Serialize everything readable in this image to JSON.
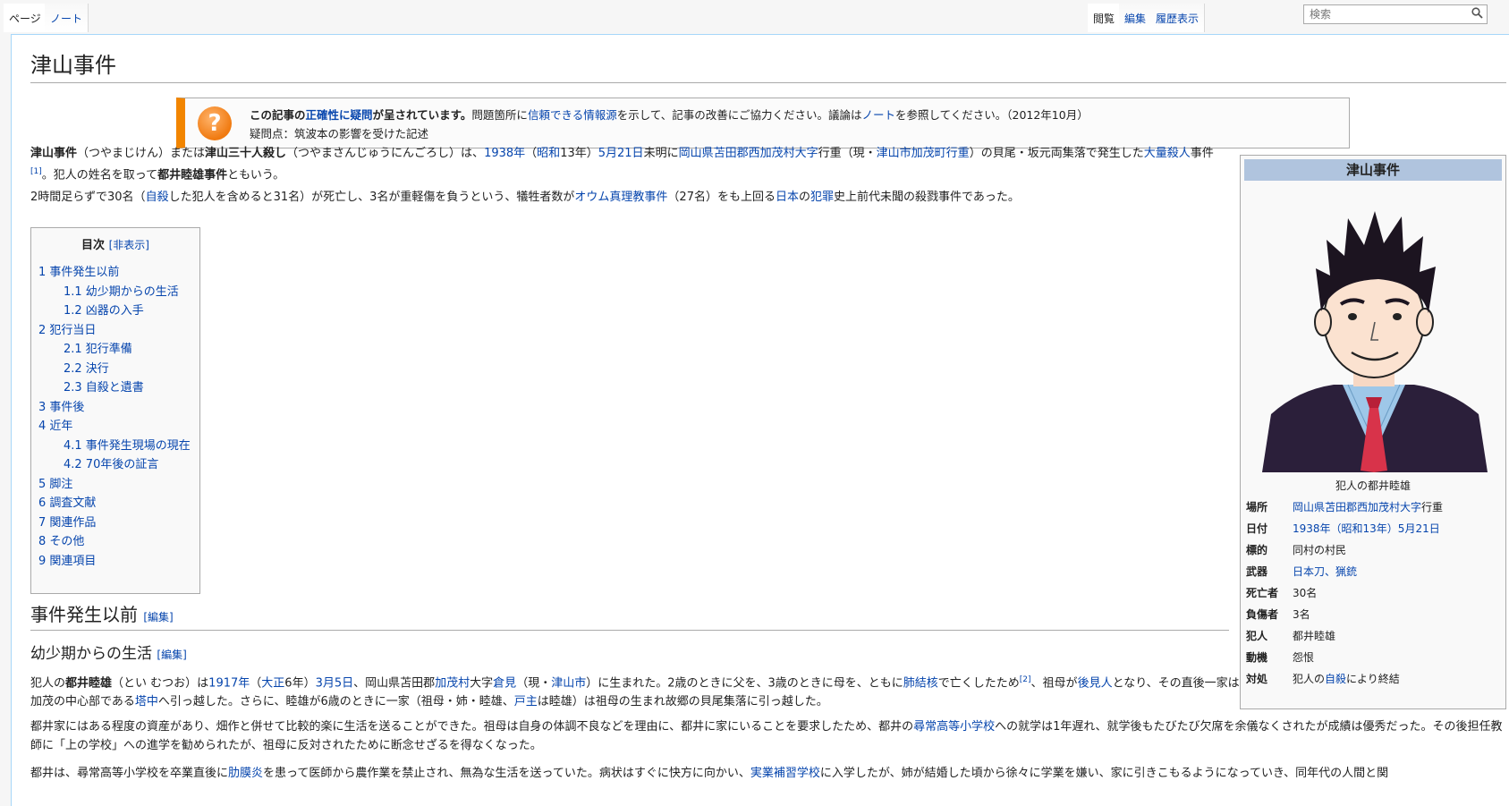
{
  "tabs": {
    "page": "ページ",
    "note": "ノート",
    "read": "閲覧",
    "edit": "編集",
    "history": "履歴表示"
  },
  "search": {
    "placeholder": "検索"
  },
  "article": {
    "title": "津山事件",
    "ambox": {
      "line1_prefix": "この記事の",
      "line1_link": "正確性に疑問",
      "line1_bold_suffix": "が呈されています。",
      "line1_text1": "問題箇所に",
      "line1_link2": "信頼できる情報源",
      "line1_text2": "を示して、記事の改善にご協力ください。議論は",
      "line1_link3": "ノート",
      "line1_text3": "を参照してください。（2012年10月）",
      "line2": "疑問点：筑波本の影響を受けた記述"
    },
    "intro": {
      "p1_a": "津山事件",
      "p1_b": "（つやまじけん）または",
      "p1_c": "津山三十人殺し",
      "p1_d": "（つやまさんじゅうにんごろし）は、",
      "p1_link1": "1938年",
      "p1_e": "（",
      "p1_link2": "昭和",
      "p1_f": "13年）",
      "p1_link3": "5月21日",
      "p1_g": "未明に",
      "p1_link4": "岡山県",
      "p1_link5": "苫田郡",
      "p1_link6": "西加茂村",
      "p1_link7": "大字",
      "p1_h": "行重（現・",
      "p1_link8": "津山市",
      "p1_link9": "加茂町行重",
      "p1_i": "）の貝尾・坂元両集落で発生した",
      "p1_link10": "大量殺人",
      "p1_j": "事件",
      "p1_ref": "[1]",
      "p1_k": "。犯人の姓名を取って",
      "p1_l": "都井睦雄事件",
      "p1_m": "ともいう。",
      "p2_a": "2時間足らずで30名（",
      "p2_link1": "自殺",
      "p2_b": "した犯人を含めると31名）が死亡し、3名が重軽傷を負うという、犠牲者数が",
      "p2_link2": "オウム真理教事件",
      "p2_c": "（27名）をも上回る",
      "p2_link3": "日本",
      "p2_d": "の",
      "p2_link4": "犯罪",
      "p2_e": "史上前代未聞の殺戮事件であった。"
    },
    "toc": {
      "title": "目次",
      "toggle": "[非表示]",
      "items": [
        {
          "text": "1 事件発生以前",
          "level": 1
        },
        {
          "text": "1.1 幼少期からの生活",
          "level": 2
        },
        {
          "text": "1.2 凶器の入手",
          "level": 2
        },
        {
          "text": "2 犯行当日",
          "level": 1
        },
        {
          "text": "2.1 犯行準備",
          "level": 2
        },
        {
          "text": "2.2 決行",
          "level": 2
        },
        {
          "text": "2.3 自殺と遺書",
          "level": 2
        },
        {
          "text": "3 事件後",
          "level": 1
        },
        {
          "text": "4 近年",
          "level": 1
        },
        {
          "text": "4.1 事件発生現場の現在",
          "level": 2
        },
        {
          "text": "4.2 70年後の証言",
          "level": 2
        },
        {
          "text": "5 脚注",
          "level": 1
        },
        {
          "text": "6 調査文献",
          "level": 1
        },
        {
          "text": "7 関連作品",
          "level": 1
        },
        {
          "text": "8 その他",
          "level": 1
        },
        {
          "text": "9 関連項目",
          "level": 1
        }
      ]
    },
    "section1": {
      "heading": "事件発生以前",
      "edit": "[編集]"
    },
    "section1_1": {
      "heading": "幼少期からの生活",
      "edit": "[編集]",
      "p1_a": "犯人の",
      "p1_b": "都井睦雄",
      "p1_c": "（とい むつお）は",
      "p1_link1": "1917年",
      "p1_d": "（",
      "p1_link2": "大正",
      "p1_e": "6年）",
      "p1_link3": "3月5日",
      "p1_f": "、岡山県苫田郡",
      "p1_link4": "加茂村",
      "p1_g": "大字",
      "p1_link5": "倉見",
      "p1_h": "（現・",
      "p1_link6": "津山市",
      "p1_i": "）に生まれた。2歳のときに父を、3歳のときに母を、ともに",
      "p1_link7": "肺結核",
      "p1_j": "で亡くしたため",
      "p1_ref": "[2]",
      "p1_k": "、祖母が",
      "p1_link8": "後見人",
      "p1_l": "となり、その直後一家は加茂の中心部である",
      "p1_link9": "塔中",
      "p1_m": "へ引っ越した。さらに、睦雄が6歳のときに一家（祖母・姉・睦雄、",
      "p1_link10": "戸主",
      "p1_n": "は睦雄）は祖母の生まれ故郷の貝尾集落に引っ越した。",
      "p2_a": "都井家にはある程度の資産があり、畑作と併せて比較的楽に生活を送ることができた。祖母は自身の体調不良などを理由に、都井に家にいることを要求したため、都井の",
      "p2_link1": "尋常高等小学校",
      "p2_b": "への就学は1年遅れ、就学後もたびたび欠席を余儀なくされたが成績は優秀だった。その後担任教師に「上の学校」への進学を勧められたが、祖母に反対されたために断念せざるを得なくなった。",
      "p3_a": "都井は、尋常高等小学校を卒業直後に",
      "p3_link1": "肋膜炎",
      "p3_b": "を患って医師から農作業を禁止され、無為な生活を送っていた。病状はすぐに快方に向かい、",
      "p3_link2": "実業補習学校",
      "p3_c": "に入学したが、姉が結婚した頃から徐々に学業を嫌い、家に引きこもるようになっていき、同年代の人間と関"
    },
    "infobox": {
      "title": "津山事件",
      "caption": "犯人の都井睦雄",
      "rows": [
        {
          "label": "場所",
          "value": "岡山県苫田郡西加茂村大字行重",
          "link_part": "岡山県苫田郡西加茂村大字",
          "plain_part": "行重"
        },
        {
          "label": "日付",
          "value": "1938年（昭和13年）5月21日"
        },
        {
          "label": "標的",
          "value": "同村の村民"
        },
        {
          "label": "武器",
          "value": "日本刀、猟銃"
        },
        {
          "label": "死亡者",
          "value": "30名"
        },
        {
          "label": "負傷者",
          "value": "3名"
        },
        {
          "label": "犯人",
          "value": "都井睦雄"
        },
        {
          "label": "動機",
          "value": "怨恨"
        },
        {
          "label": "対処",
          "value_a": "犯人の",
          "value_link": "自殺",
          "value_b": "により終結"
        }
      ]
    }
  },
  "colors": {
    "link": "#0645ad",
    "ambox_border": "#f28500",
    "infobox_title_bg": "#b0c4de",
    "tab_border": "#a7d7f9"
  }
}
